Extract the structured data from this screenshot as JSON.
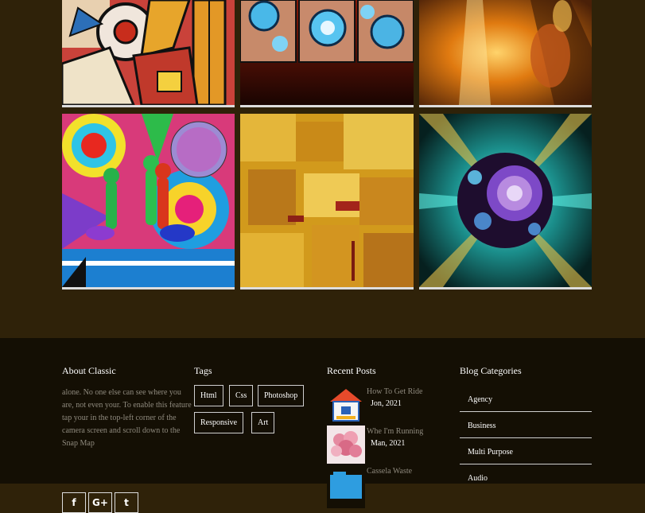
{
  "gallery": {
    "images": [
      {
        "alt": "cubist-guitar-painting"
      },
      {
        "alt": "blue-swirl-triptych"
      },
      {
        "alt": "golden-face-painting"
      },
      {
        "alt": "psychedelic-disco-figures"
      },
      {
        "alt": "yellow-abstract-painting"
      },
      {
        "alt": "teal-crystal-sphere"
      }
    ]
  },
  "footer": {
    "about": {
      "heading": "About Classic",
      "text": "alone. No one else can see where you are, not even your. To enable this feature tap your in the top-left corner of the camera screen and scroll down to the Snap Map",
      "social": [
        "f",
        "G+",
        "t"
      ]
    },
    "tags": {
      "heading": "Tags",
      "items": [
        "Html",
        "Css",
        "Photoshop",
        "Responsive",
        "Art"
      ]
    },
    "recent_posts": {
      "heading": "Recent Posts",
      "items": [
        {
          "title": "How To Get Ride",
          "date": "Jon, 2021"
        },
        {
          "title": "Whe I'm Running",
          "date": "Man, 2021"
        },
        {
          "title": "Cassela Waste",
          "date": ""
        }
      ]
    },
    "categories": {
      "heading": "Blog Categories",
      "items": [
        "Agency",
        "Business",
        "Multi Purpose",
        "Audio"
      ]
    }
  }
}
